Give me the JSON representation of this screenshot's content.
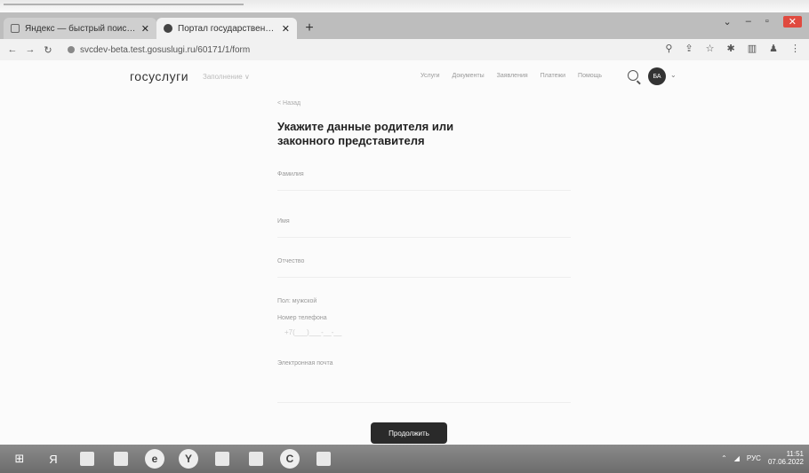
{
  "browser": {
    "tabs": [
      {
        "title": "Яндекс — быстрый поиск в ин",
        "close": "✕"
      },
      {
        "title": "Портал государственных услуг",
        "close": "✕"
      }
    ],
    "new_tab": "+",
    "url": "svcdev-beta.test.gosuslugi.ru/60171/1/form"
  },
  "header": {
    "logo": "госуслуги",
    "region": "Заполнение ∨",
    "nav": [
      "Услуги",
      "Документы",
      "Заявления",
      "Платежи",
      "Помощь"
    ],
    "avatar_initials": "БА"
  },
  "form": {
    "back_link": "< Назад",
    "heading": "Укажите данные родителя или законного представителя",
    "fields": [
      {
        "label": "Фамилия"
      },
      {
        "label": "Имя"
      },
      {
        "label": "Отчество"
      },
      {
        "label": "Пол: мужской"
      },
      {
        "label": "Номер телефона",
        "mask": "+7(___)___-__-__"
      },
      {
        "label": "Электронная почта"
      }
    ],
    "continue_label": "Продолжить"
  },
  "taskbar": {
    "tray_lang": "РУС",
    "time": "11:51",
    "date": "07.06.2022"
  }
}
